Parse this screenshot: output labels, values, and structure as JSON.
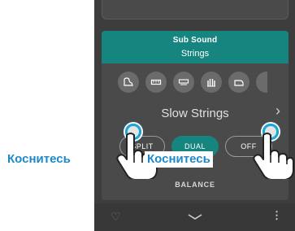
{
  "panel": {
    "title": "Sub Sound",
    "subtitle": "Strings",
    "voice_name": "Slow Strings",
    "chevron": "›",
    "instrument_icons": [
      "grand-piano-icon",
      "electric-piano-icon",
      "electric-piano-2-icon",
      "organ-icon",
      "harpsichord-icon"
    ]
  },
  "mode_buttons": {
    "split": "SPLIT",
    "dual": "DUAL",
    "off": "OFF",
    "active": "DUAL"
  },
  "balance_label": "BALANCE",
  "annotations": {
    "left": "Коснитесь",
    "right": "Коснитесь"
  },
  "colors": {
    "accent": "#17857f",
    "annotation": "#1e88c8",
    "touch_ring": "#19a7d9"
  },
  "bottom_bar": {
    "favorite": "heart-icon",
    "collapse": "chevron-down-icon",
    "menu": "more-vertical-icon"
  }
}
